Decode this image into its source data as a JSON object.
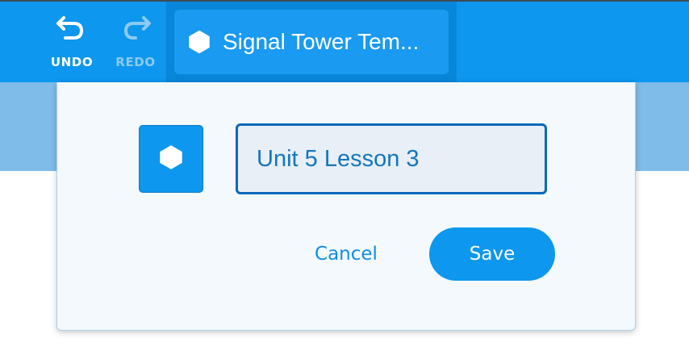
{
  "toolbar": {
    "undo_label": "UNDO",
    "redo_label": "REDO",
    "undo_icon": "undo-arrow-icon",
    "redo_icon": "redo-arrow-icon",
    "redo_disabled": true
  },
  "project": {
    "title": "Signal Tower Tem...",
    "icon": "hexagon-icon"
  },
  "rename_dialog": {
    "icon": "hexagon-icon",
    "name_value": "Unit 5 Lesson 3",
    "cancel_label": "Cancel",
    "save_label": "Save"
  },
  "colors": {
    "toolbar_bg": "#0d97ee",
    "accent": "#0d97ee",
    "input_border": "#0b69b8",
    "disabled_text": "#8ccaf2"
  }
}
